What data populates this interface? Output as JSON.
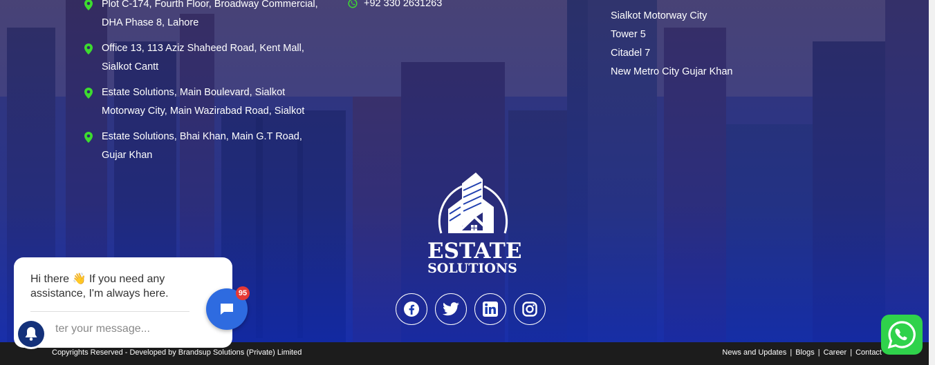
{
  "addresses": [
    {
      "line1": "Plot C-174, Fourth Floor, Broadway Commercial,",
      "line2": "DHA Phase 8, Lahore"
    },
    {
      "line1": "Office 13, 113 Aziz Shaheed Road, Kent Mall,",
      "line2": "Sialkot Cantt"
    },
    {
      "line1": "Estate Solutions, Main Boulevard, Sialkot",
      "line2": "Motorway City, Main Wazirabad Road, Sialkot"
    },
    {
      "line1": "Estate Solutions, Bhai Khan, Main G.T Road,",
      "line2": "Gujar Khan"
    }
  ],
  "phone": "+92 330 2631263",
  "projects": [
    "Sialkot Motorway City",
    "Tower 5",
    "Citadel 7",
    "New Metro City Gujar Khan"
  ],
  "logo": {
    "line1": "ESTATE",
    "line2": "SOLUTIONS"
  },
  "social": [
    "facebook-icon",
    "twitter-icon",
    "linkedin-icon",
    "instagram-icon"
  ],
  "footer": {
    "copyright": "Copyrights Reserved - Developed by Brandsup Solutions (Private) Limited",
    "links": [
      "News and Updates",
      "Blogs",
      "Career",
      "Contact"
    ],
    "separator": "|"
  },
  "chat": {
    "message": "Hi there 👋 If you need any assistance, I'm always here.",
    "placeholder": "ter your message...",
    "badge": "95"
  },
  "colors": {
    "whatsapp": "#2fd24b",
    "chat_button": "#2e6be0",
    "badge": "#e53935",
    "pin": "#3ddc2f"
  }
}
